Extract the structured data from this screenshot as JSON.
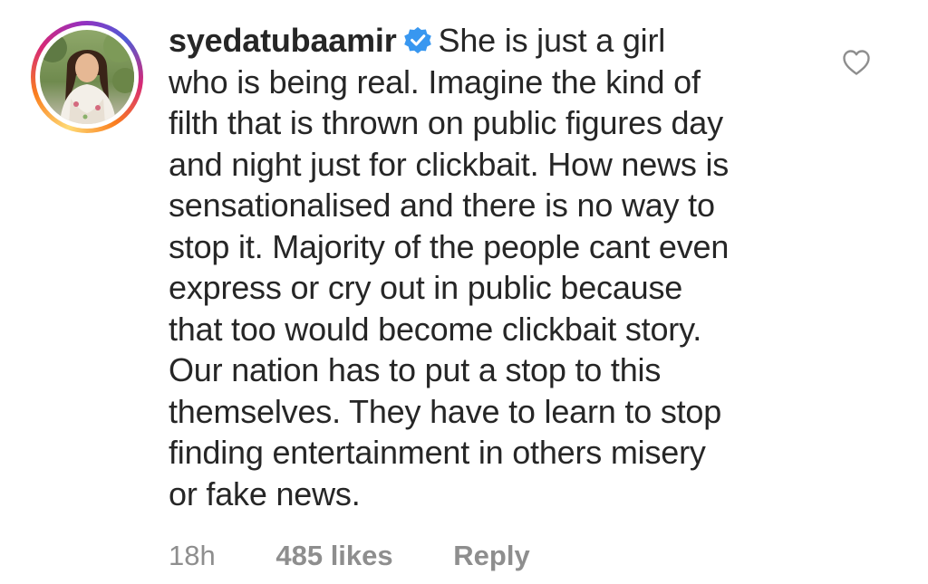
{
  "comment": {
    "username": "syedatubaamir",
    "verified_icon": "verified-badge-icon",
    "text_lines": [
      "She is just a girl",
      "who is being real. Imagine the kind of",
      "filth that is thrown on public figures day",
      "and night just for clickbait. How news is",
      "sensationalised and there is no way to",
      "stop it. Majority of the people cant even",
      "express or cry out in public because",
      "that too would become clickbait story.",
      "Our nation has to put a stop to this",
      "themselves. They have to learn to stop",
      "finding entertainment in others misery",
      "or fake news."
    ],
    "like_icon": "heart-outline-icon"
  },
  "footer": {
    "timestamp": "18h",
    "likes": "485 likes",
    "reply_label": "Reply"
  },
  "colors": {
    "text": "#262626",
    "secondary_text": "#8e8e8e",
    "verified_blue": "#3897f0",
    "background": "#ffffff"
  }
}
